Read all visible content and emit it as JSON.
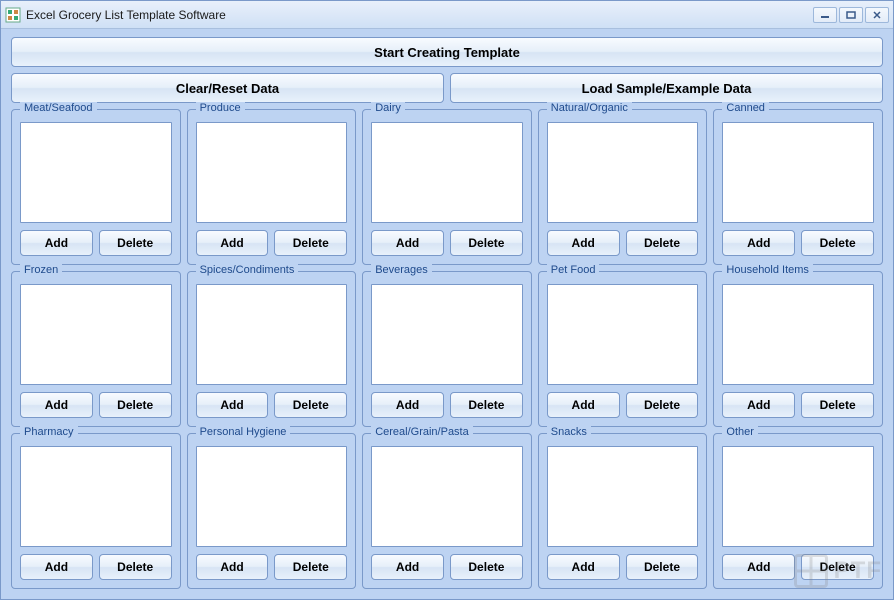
{
  "window": {
    "title": "Excel Grocery List Template Software"
  },
  "buttons": {
    "start": "Start Creating Template",
    "clear": "Clear/Reset Data",
    "load": "Load Sample/Example Data",
    "add": "Add",
    "delete": "Delete"
  },
  "categories": [
    {
      "label": "Meat/Seafood"
    },
    {
      "label": "Produce"
    },
    {
      "label": "Dairy"
    },
    {
      "label": "Natural/Organic"
    },
    {
      "label": "Canned"
    },
    {
      "label": "Frozen"
    },
    {
      "label": "Spices/Condiments"
    },
    {
      "label": "Beverages"
    },
    {
      "label": "Pet Food"
    },
    {
      "label": "Household Items"
    },
    {
      "label": "Pharmacy"
    },
    {
      "label": "Personal Hygiene"
    },
    {
      "label": "Cereal/Grain/Pasta"
    },
    {
      "label": "Snacks"
    },
    {
      "label": "Other"
    }
  ],
  "watermark": "PTF"
}
